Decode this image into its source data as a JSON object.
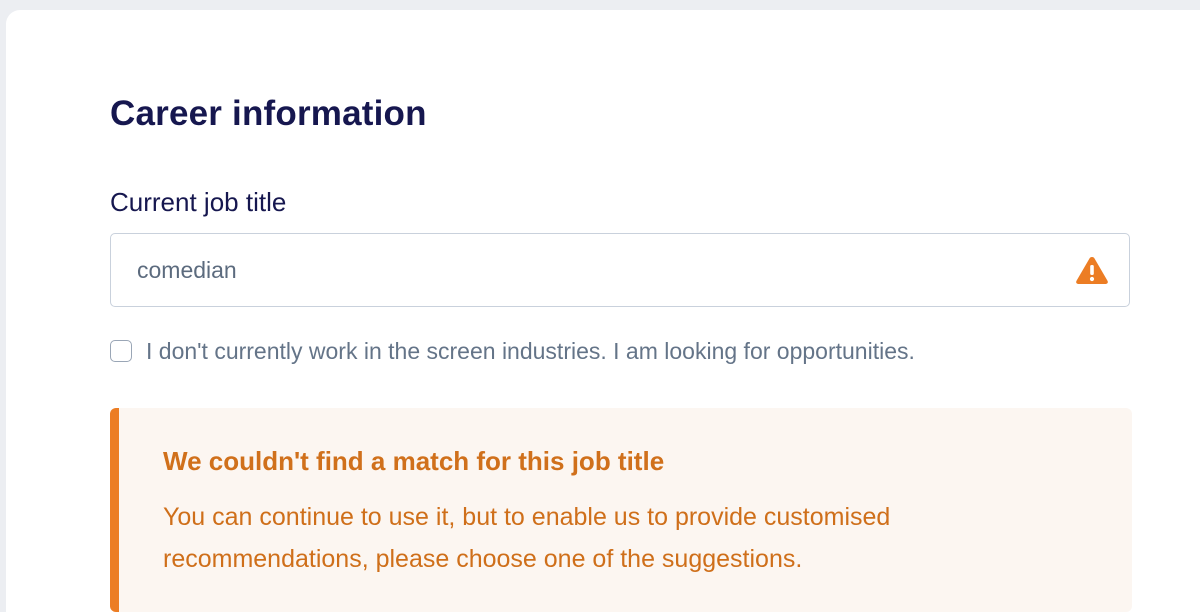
{
  "section": {
    "title": "Career information"
  },
  "job_title_field": {
    "label": "Current job title",
    "value": "comedian",
    "status_icon": "warning-triangle-icon"
  },
  "not_in_industry_checkbox": {
    "label": "I don't currently work in the screen industries. I am looking for opportunities.",
    "checked": false
  },
  "alert": {
    "title": "We couldn't find a match for this job title",
    "message": "You can continue to use it, but to enable us to provide customised recommendations, please choose one of the suggestions."
  },
  "colors": {
    "heading": "#16174f",
    "warning": "#ec7d24",
    "alert_text": "#cf6f1a",
    "alert_background": "#fcf6f1",
    "muted_text": "#647488"
  }
}
